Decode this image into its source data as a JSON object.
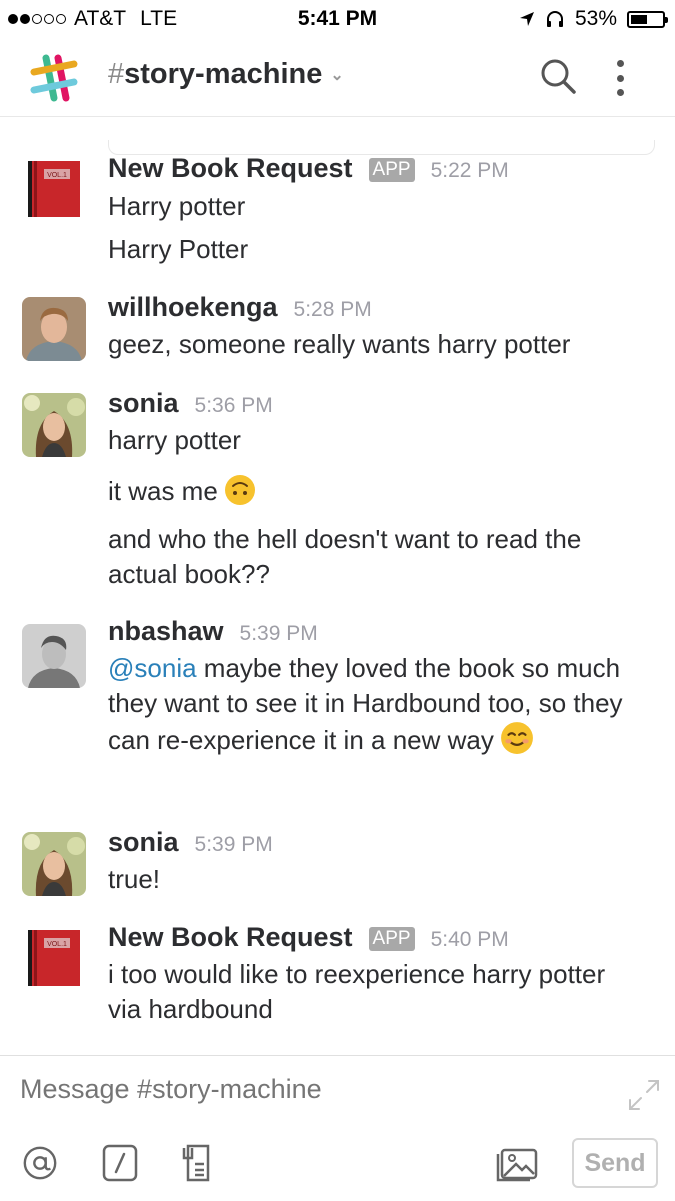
{
  "status_bar": {
    "carrier": "AT&T",
    "network": "LTE",
    "time": "5:41 PM",
    "battery": "53%",
    "battery_level": 0.53
  },
  "header": {
    "channel": "story-machine",
    "hash": "#"
  },
  "messages": [
    {
      "author": "New Book Request",
      "badge": "APP",
      "time": "5:22 PM",
      "avatar": "red-book-icon",
      "lines": [
        "Harry potter",
        "Harry Potter"
      ]
    },
    {
      "author": "willhoekenga",
      "time": "5:28 PM",
      "avatar": "user-photo",
      "lines": [
        "geez, someone really wants harry potter"
      ]
    },
    {
      "author": "sonia",
      "time": "5:36 PM",
      "avatar": "user-photo",
      "lines": [
        "harry potter",
        "it was me",
        "and who the hell doesn't want to read the actual book??"
      ]
    },
    {
      "author": "nbashaw",
      "time": "5:39 PM",
      "avatar": "user-photo",
      "mention": "@sonia",
      "lines": [
        "maybe they loved the book so much they want to see it in Hardbound too, so they can re-experience it in a new way"
      ]
    },
    {
      "author": "sonia",
      "time": "5:39 PM",
      "avatar": "user-photo",
      "lines": [
        "true!"
      ]
    },
    {
      "author": "New Book Request",
      "badge": "APP",
      "time": "5:40 PM",
      "avatar": "red-book-icon",
      "lines": [
        "i too would like to reexperience harry potter via hardbound"
      ]
    }
  ],
  "composer": {
    "placeholder": "Message #story-machine",
    "send_label": "Send"
  },
  "colors": {
    "mention": "#2a80b9",
    "badge": "#a8a8a8",
    "timestamp": "#9e9ea6",
    "book": "#c8262a"
  }
}
